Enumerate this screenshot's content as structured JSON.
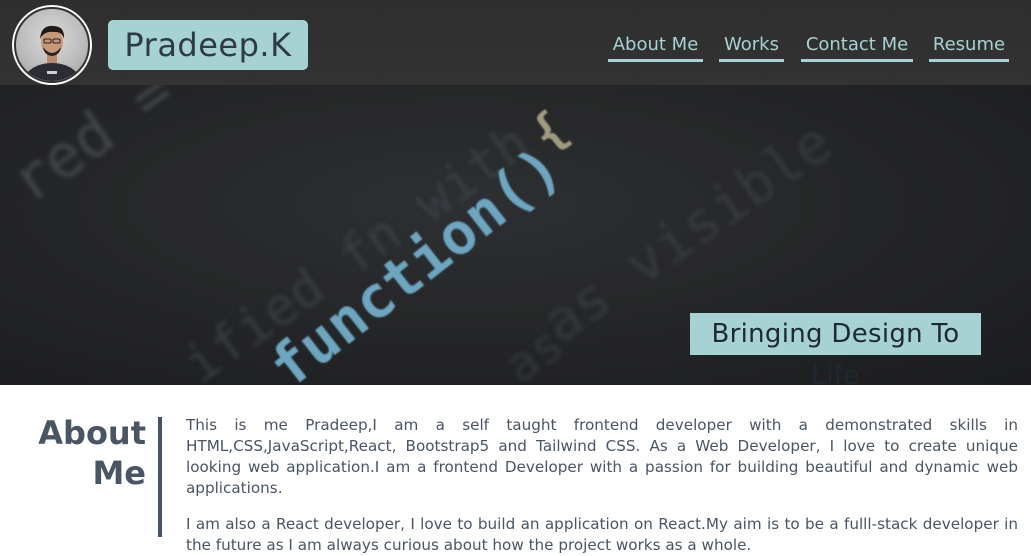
{
  "header": {
    "brand": "Pradeep.K",
    "nav": [
      {
        "label": "About Me"
      },
      {
        "label": "Works"
      },
      {
        "label": "Contact Me"
      },
      {
        "label": "Resume"
      }
    ]
  },
  "hero": {
    "code_words": [
      "function()",
      "{",
      "ified fn with",
      "as visible",
      "red =",
      "as"
    ],
    "tagline": "Bringing Design To Life"
  },
  "about": {
    "title_line1": "About",
    "title_line2": "Me",
    "paragraphs": [
      "This is me Pradeep,I am a self taught frontend developer with a demonstrated skills in HTML,CSS,JavaScript,React, Bootstrap5 and Tailwind CSS. As a Web Developer, I love to create unique looking web application.I am a frontend Developer with a passion for building beautiful and dynamic web applications.",
      "I am also a React developer, I love to build an application on React.My aim is to be a fulll-stack developer in the future as I am always curious about how the project works as a whole."
    ]
  },
  "colors": {
    "accent": "#a6d2d3",
    "header_bg": "#333333",
    "text": "#4a5563"
  },
  "icons": {
    "avatar": "profile-photo"
  }
}
